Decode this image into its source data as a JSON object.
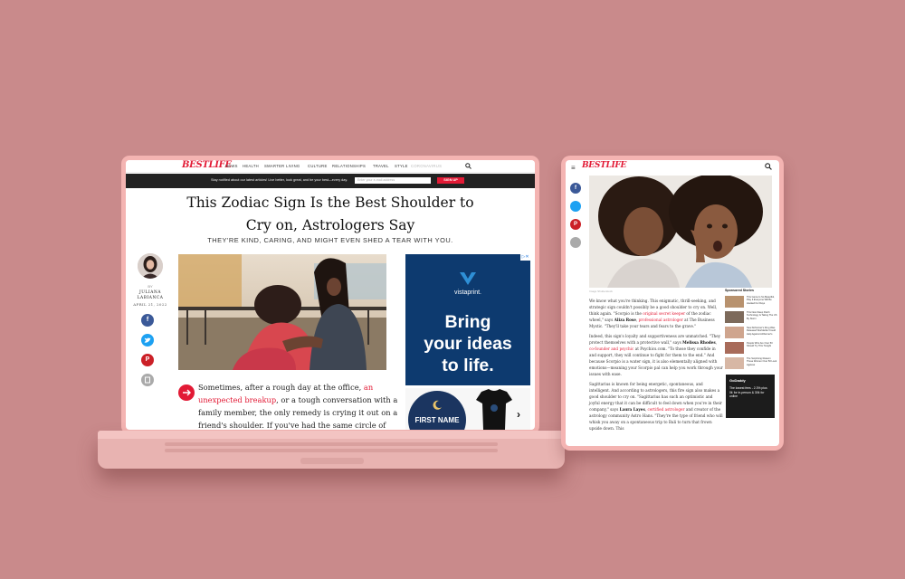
{
  "background_color": "#c98a8b",
  "accent_color": "#e21a35",
  "laptop": {
    "nav": {
      "logo": "BESTLIFE",
      "items": [
        "NEWS",
        "HEALTH",
        "SMARTER LIVING",
        "CULTURE",
        "RELATIONSHIPS",
        "TRAVEL",
        "STYLE",
        "CORONAVIRUS"
      ],
      "search_icon": "search-icon"
    },
    "banner": {
      "text": "Stay notified about our latest articles! Live better, look great, and be your best—every day.",
      "email_placeholder": "Enter your e-mail address",
      "signup_label": "SIGN UP"
    },
    "article": {
      "title": "This Zodiac Sign Is the Best Shoulder to Cry on, Astrologers Say",
      "subtitle": "THEY'RE KIND, CARING, AND MIGHT EVEN SHED A TEAR WITH YOU.",
      "byline_prefix": "BY",
      "author": "JULIANA LABIANCA",
      "date": "APRIL 21, 2022",
      "body_1": "Sometimes, after a rough day at the office, ",
      "body_link": "an unexpected breakup",
      "body_2": ", or a tough conversation with a family member, the only remedy is crying it out on a friend's shoulder. If you've had the same circle of companions for a"
    },
    "share_icons": [
      "facebook-icon",
      "twitter-icon",
      "pinterest-icon",
      "print-icon"
    ],
    "ad": {
      "brand": "vistaprint.",
      "headline_1": "Bring",
      "headline_2": "your ideas",
      "headline_3": "to life.",
      "badge_text": "FIRST NAME"
    }
  },
  "tablet": {
    "logo": "BESTLIFE",
    "caption": "Imago Shutterstock",
    "paragraphs": {
      "p1_a": "We know what you're thinking. This enigmatic, thrill-seeking, and strategic sign couldn't possibly be a good shoulder to cry on. Well, think again. \"Scorpio is the ",
      "p1_link1": "original secret keeper",
      "p1_b": " of the zodiac wheel,\" says ",
      "p1_name": "Aliza Rose",
      "p1_c": ", ",
      "p1_link2": "professional astrologer",
      "p1_d": " at The Business Mystic. \"They'll take your tears and fears to the grave.\"",
      "p2_a": "Indeed, this sign's loyalty and supportiveness are unmatched. \"They protect themselves with a protective wall,\" says ",
      "p2_name": "Melissa Rhodes",
      "p2_b": ", ",
      "p2_link": "co-founder and psychic",
      "p2_c": " at Psychics.com. \"To those they confide in and support, they will continue to fight for them to the end.\" And because Scorpio is a water sign, it is also elementally aligned with emotions—meaning your Scorpio pal can help you work through your issues with ease.",
      "p3_a": "Sagittarius is known for being energetic, spontaneous, and intelligent. And according to astrologers, this fire sign also makes a good shoulder to cry on. \"Sagittarius has such an optimistic and joyful energy that it can be difficult to feel down when you're in their company,\" says ",
      "p3_name": "Laura Layes",
      "p3_b": ", ",
      "p3_link": "certified astrologer",
      "p3_c": " and creator of the astrology community Astro Hans. \"They're the type of friend who will whisk you away on a spontaneous trip to Bali to turn that frown upside down. This"
    },
    "sidebar": {
      "heading": "Sponsored Stories",
      "stories": [
        "This Game Is So Beautiful, Play It Everyone Will Be Hooked For Days",
        "This New Sleep Patch Technology Is Taking The US By Storm",
        "New Alzheimer's Drug Was Released Worldwide! Could Help Against Alzheimer's",
        "People Who Are Over 50 Should Try This Tonight",
        "The Surprising Reason These Women Over 50 Look Ageless"
      ],
      "ad_brand": "GoDaddy",
      "ad_text": "The lowest fees - 2.3% plus 0¢ for in-person & 30¢ for online"
    }
  }
}
